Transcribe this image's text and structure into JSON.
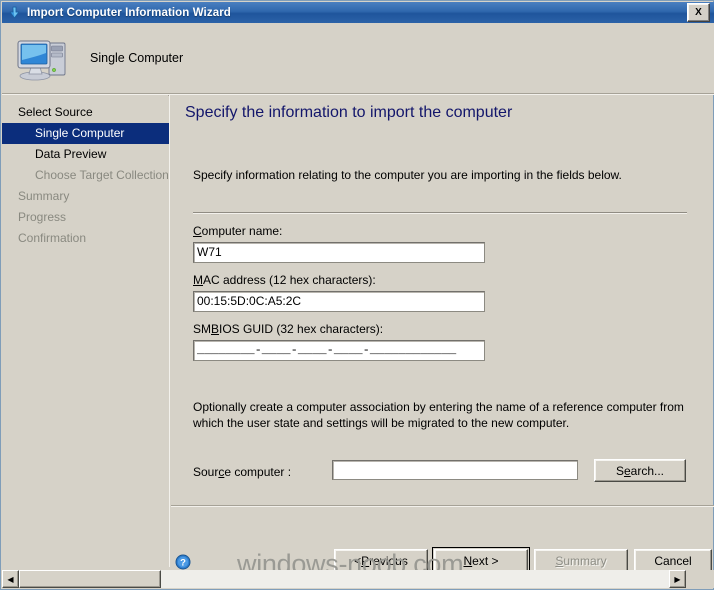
{
  "window": {
    "title": "Import Computer Information Wizard",
    "title_icon": "import-arrow-icon",
    "close_label": "X"
  },
  "header": {
    "icon": "computer-icon",
    "title": "Single Computer"
  },
  "sidebar": {
    "items": [
      {
        "label": "Select Source",
        "state": "normal",
        "indent": false
      },
      {
        "label": "Single Computer",
        "state": "selected",
        "indent": true
      },
      {
        "label": "Data Preview",
        "state": "normal",
        "indent": true
      },
      {
        "label": "Choose Target Collection",
        "state": "disabled",
        "indent": true
      },
      {
        "label": "Summary",
        "state": "disabled",
        "indent": false
      },
      {
        "label": "Progress",
        "state": "disabled",
        "indent": false
      },
      {
        "label": "Confirmation",
        "state": "disabled",
        "indent": false
      }
    ]
  },
  "main": {
    "page_title": "Specify the information to import the computer",
    "intro": "Specify information relating to the computer you are importing in the fields below.",
    "fields": {
      "computer_name": {
        "label_pre": "",
        "label_acc": "C",
        "label_post": "omputer name:",
        "value": "W71",
        "placeholder": ""
      },
      "mac_address": {
        "label_pre": "",
        "label_acc": "M",
        "label_post": "AC address (12 hex characters):",
        "value": "00:15:5D:0C:A5:2C",
        "placeholder": ""
      },
      "smbios_guid": {
        "label_pre": "SM",
        "label_acc": "B",
        "label_post": "IOS GUID (32 hex characters):",
        "value": "________-____-____-____-____________",
        "placeholder": ""
      },
      "source_computer": {
        "label_pre": "Sour",
        "label_acc": "c",
        "label_post": "e computer :",
        "value": "",
        "placeholder": ""
      }
    },
    "association_text": "Optionally create a computer association by entering the name of a reference computer from which the user state and settings will be migrated to the new computer.",
    "search_button": {
      "pre": "S",
      "acc": "e",
      "post": "arch..."
    }
  },
  "footer": {
    "help_icon": "help-question-icon",
    "buttons": [
      {
        "name": "previous",
        "pre": "< ",
        "acc": "P",
        "post": "revious",
        "state": "normal"
      },
      {
        "name": "next",
        "pre": "",
        "acc": "N",
        "post": "ext >",
        "state": "default"
      },
      {
        "name": "summary",
        "pre": "",
        "acc": "S",
        "post": "ummary",
        "state": "disabled"
      },
      {
        "name": "cancel",
        "pre": "",
        "acc": "",
        "post": "Cancel",
        "state": "normal"
      }
    ]
  },
  "watermark": "windows-noob.com",
  "scrollbar": {
    "left_arrow": "◀",
    "right_arrow": "▶"
  },
  "colors": {
    "titlebar": "#2f67ad",
    "selection": "#0b2d7c",
    "heading": "#13166b",
    "face": "#d6d2c8"
  }
}
